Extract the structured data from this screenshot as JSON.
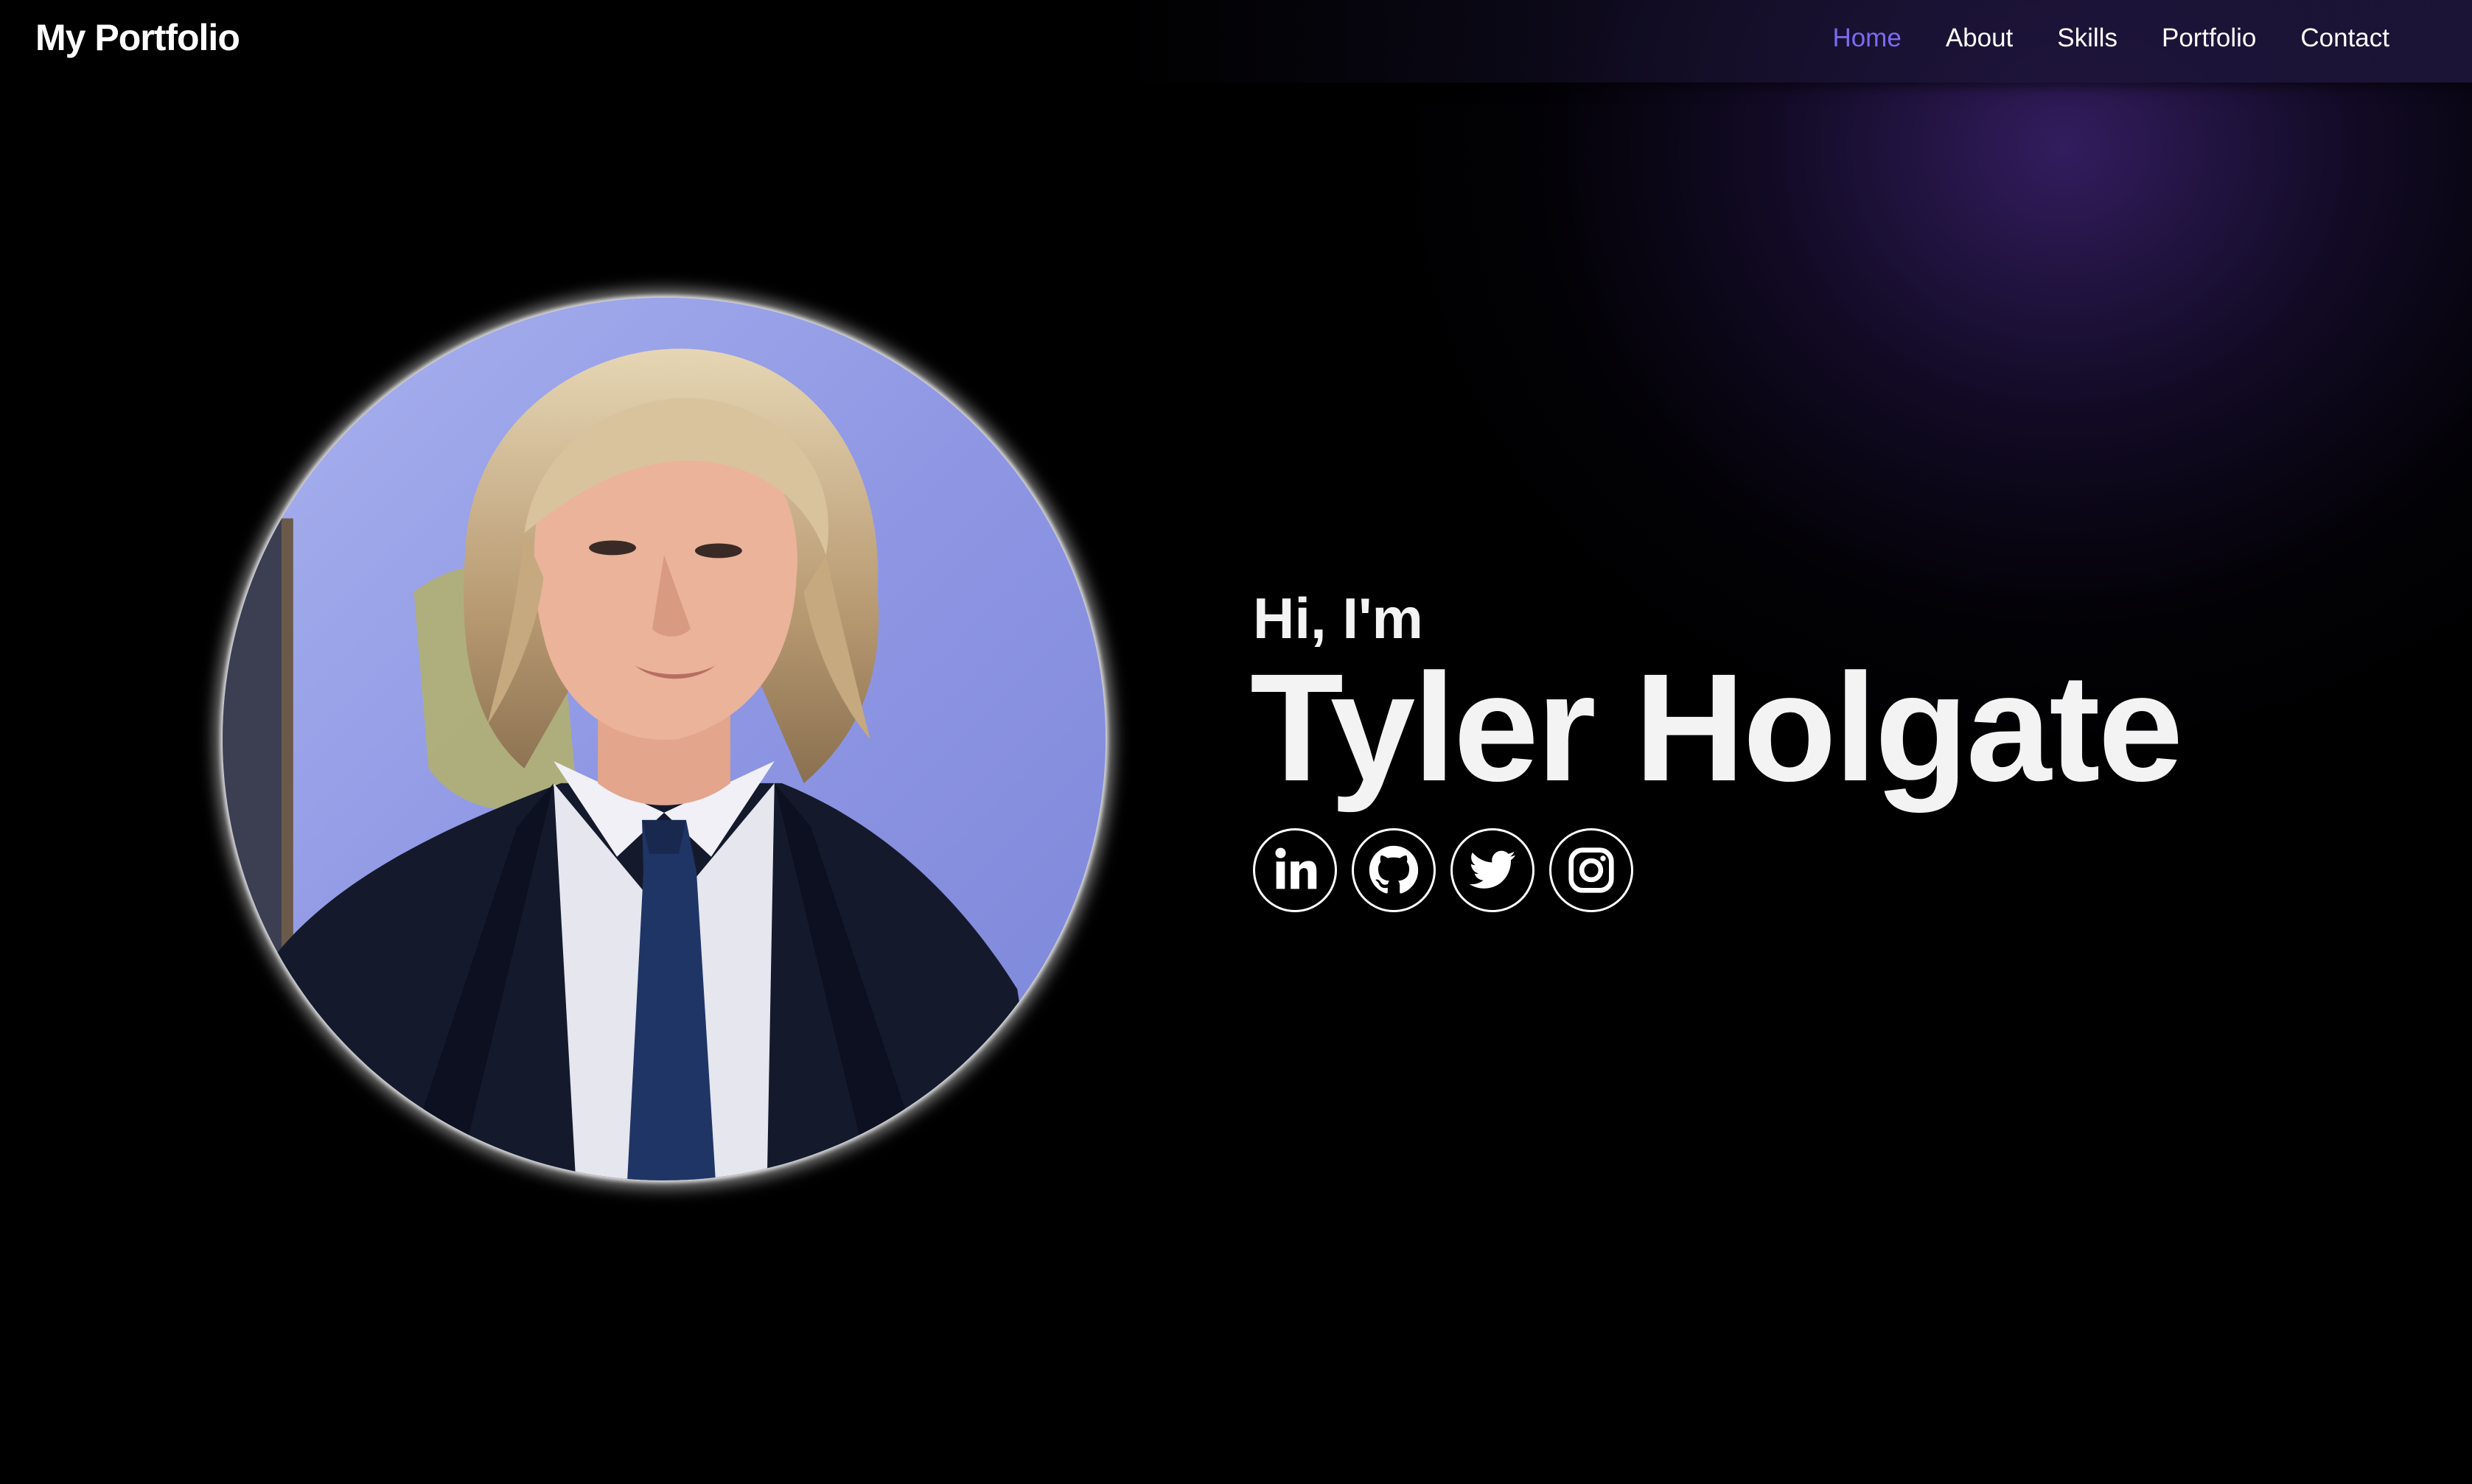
{
  "header": {
    "brand": "My Portfolio",
    "nav": [
      {
        "label": "Home",
        "active": true
      },
      {
        "label": "About",
        "active": false
      },
      {
        "label": "Skills",
        "active": false
      },
      {
        "label": "Portfolio",
        "active": false
      },
      {
        "label": "Contact",
        "active": false
      }
    ]
  },
  "hero": {
    "greeting": "Hi, I'm",
    "name": "Tyler Holgate",
    "socials": [
      {
        "icon": "linkedin-icon"
      },
      {
        "icon": "github-icon"
      },
      {
        "icon": "twitter-icon"
      },
      {
        "icon": "instagram-icon"
      }
    ]
  },
  "colors": {
    "background": "#000000",
    "accent": "#7b6cf0",
    "text": "#f3f3f3",
    "glow": "#382068"
  }
}
